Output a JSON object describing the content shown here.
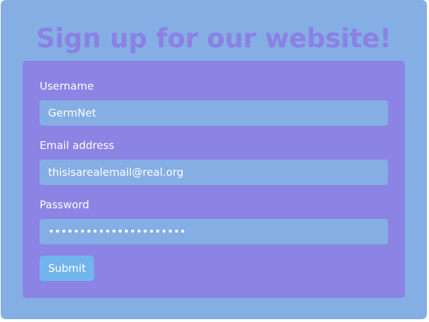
{
  "page": {
    "title": "Sign up for our website!"
  },
  "form": {
    "username": {
      "label": "Username",
      "value": "GermNet"
    },
    "email": {
      "label": "Email address",
      "value": "thisisarealemail@real.org"
    },
    "password": {
      "label": "Password",
      "value": "••••••••••••••••••••••"
    },
    "submit_label": "Submit"
  },
  "colors": {
    "page_background": "#84aee4",
    "title_text": "#8b80e4",
    "form_background": "#8b84e4",
    "input_background": "#84aee4",
    "submit_background": "#72b4ec",
    "label_text": "#ffffff"
  }
}
